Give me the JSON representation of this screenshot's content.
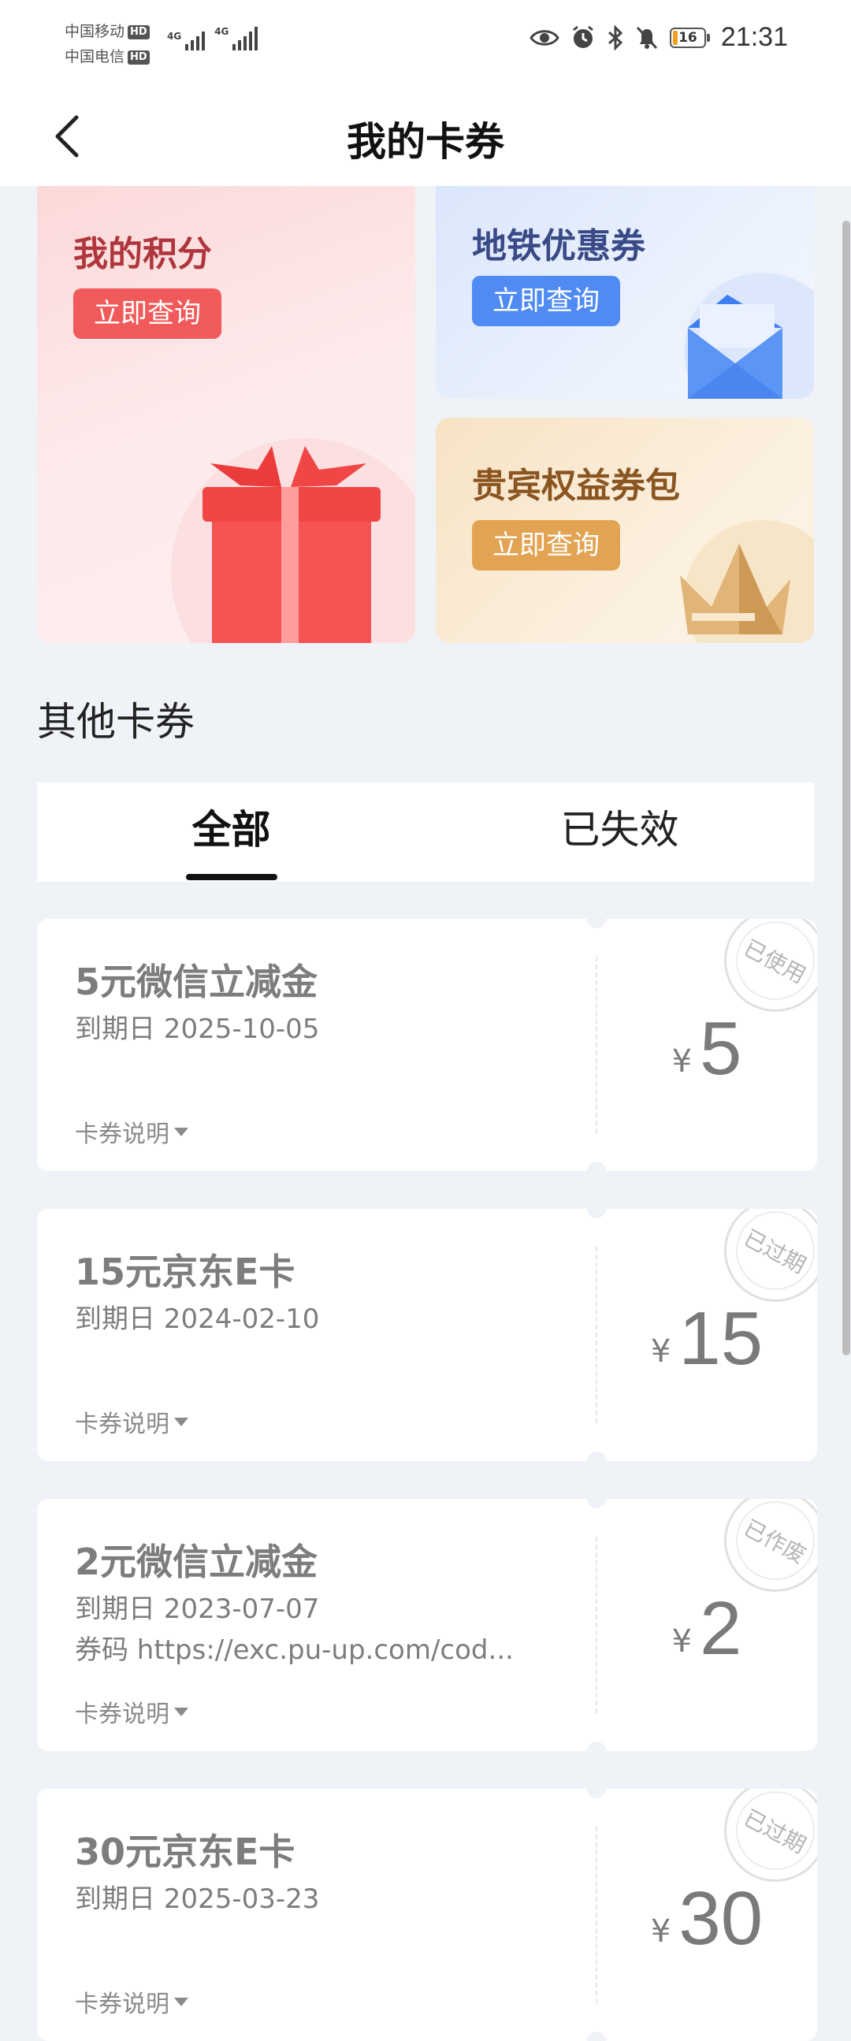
{
  "status_bar": {
    "carrier1": "中国移动",
    "carrier2": "中国电信",
    "hd": "HD",
    "net": "4G",
    "battery": "16",
    "time": "21:31"
  },
  "nav": {
    "title": "我的卡券"
  },
  "promos": {
    "points": {
      "title": "我的积分",
      "button": "立即查询"
    },
    "metro": {
      "title": "地铁优惠券",
      "button": "立即查询"
    },
    "vip": {
      "title": "贵宾权益券包",
      "button": "立即查询"
    }
  },
  "section": {
    "title": "其他卡券"
  },
  "tabs": {
    "all": "全部",
    "expired": "已失效"
  },
  "coupons": [
    {
      "name": "5元微信立减金",
      "date": "到期日 2025-10-05",
      "code": "",
      "desc": "卡券说明",
      "currency": "¥",
      "amount": "5",
      "stamp": "已使用"
    },
    {
      "name": "15元京东E卡",
      "date": "到期日 2024-02-10",
      "code": "",
      "desc": "卡券说明",
      "currency": "¥",
      "amount": "15",
      "stamp": "已过期"
    },
    {
      "name": "2元微信立减金",
      "date": "到期日 2023-07-07",
      "code": "券码  https://exc.pu-up.com/cod...",
      "desc": "卡券说明",
      "currency": "¥",
      "amount": "2",
      "stamp": "已作废"
    },
    {
      "name": "30元京东E卡",
      "date": "到期日 2025-03-23",
      "code": "",
      "desc": "卡券说明",
      "currency": "¥",
      "amount": "30",
      "stamp": "已过期"
    }
  ],
  "colors": {
    "points_accent": "#f15a5a",
    "metro_accent": "#4f8bf3",
    "vip_accent": "#e2a352",
    "background": "#eff2f6"
  }
}
